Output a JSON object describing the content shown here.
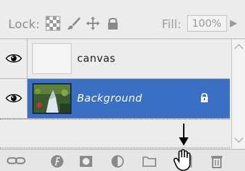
{
  "lockbar": {
    "lock_label": "Lock:",
    "fill_label": "Fill:",
    "fill_value": "100%",
    "fill_arrow": "▶"
  },
  "layers": [
    {
      "name": "canvas",
      "visible": true,
      "selected": false
    },
    {
      "name": "Background",
      "visible": true,
      "selected": true,
      "locked": true
    }
  ],
  "colors": {
    "selected_row": "#3a6fc4",
    "panel_bg": "#ececec"
  },
  "toolbar": {
    "icons": [
      "link-layers-icon",
      "layer-style-icon",
      "add-mask-icon",
      "adjustment-layer-icon",
      "new-group-icon",
      "new-layer-icon",
      "delete-layer-icon"
    ]
  }
}
